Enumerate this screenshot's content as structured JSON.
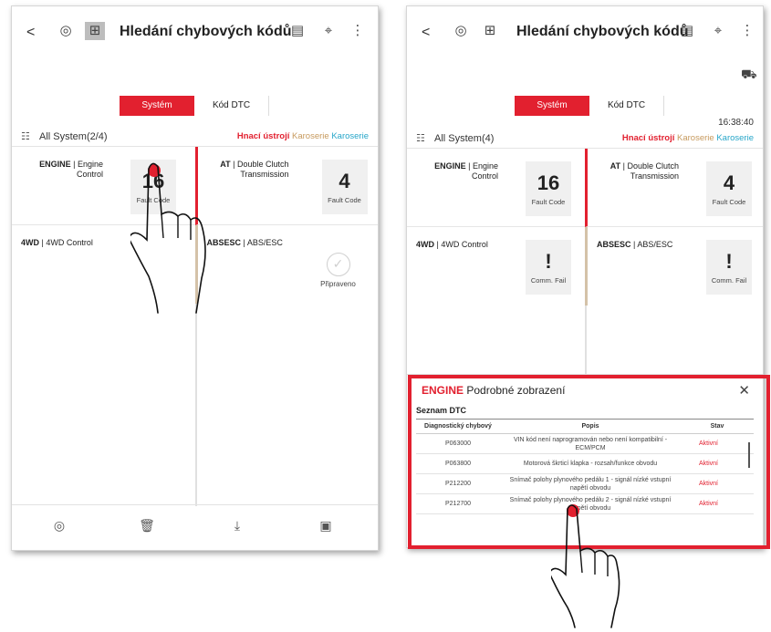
{
  "common": {
    "back": "<",
    "title": "Hledání chybových kódů",
    "tabs": [
      "Systém",
      "Kód DTC"
    ],
    "filter_drive": "Hnací ústrojí",
    "filter_body1": "Karoserie",
    "filter_body2": "Karoserie",
    "fault_caption": "Fault Code",
    "comm_caption": "Comm. Fail",
    "ready_caption": "Připraveno",
    "colors": {
      "accent": "#e2202f",
      "body_filter": "#c79a5e",
      "body_filter2": "#27a6c9"
    }
  },
  "left": {
    "system_label": "All System(2/4)",
    "cells": [
      {
        "name_bold": "ENGINE",
        "name_rest": " | Engine Control",
        "count": "16",
        "caption": "Fault Code"
      },
      {
        "name_bold": "AT",
        "name_rest": " | Double Clutch Transmission",
        "count": "4",
        "caption": "Fault Code"
      },
      {
        "name_bold": "4WD",
        "name_rest": " | 4WD Control"
      },
      {
        "name_bold": "ABSESC",
        "name_rest": " | ABS/ESC",
        "caption": "Připraveno"
      }
    ],
    "bottom_icons": [
      "circle-icon",
      "trash-icon",
      "download-icon",
      "report-icon"
    ]
  },
  "right": {
    "system_label": "All System(4)",
    "time": "16:38:40",
    "cells": [
      {
        "name_bold": "ENGINE",
        "name_rest": " | Engine Control",
        "count": "16",
        "caption": "Fault Code"
      },
      {
        "name_bold": "AT",
        "name_rest": " | Double Clutch Transmission",
        "count": "4",
        "caption": "Fault Code"
      },
      {
        "name_bold": "4WD",
        "name_rest": " | 4WD Control",
        "count": "!",
        "caption": "Comm. Fail"
      },
      {
        "name_bold": "ABSESC",
        "name_rest": " | ABS/ESC",
        "count": "!",
        "caption": "Comm. Fail"
      }
    ],
    "panel": {
      "title_red": "ENGINE",
      "title_rest": " Podrobné zobrazení",
      "close": "✕",
      "subtitle": "Seznam DTC",
      "headers": [
        "Diagnostický chybový",
        "Popis",
        "Stav"
      ],
      "rows": [
        [
          "P063000",
          "VIN kód není naprogramován nebo není kompatibilní - ECM/PCM",
          "Aktivní"
        ],
        [
          "P063800",
          "Motorová škrticí klapka - rozsah/funkce obvodu",
          "Aktivní"
        ],
        [
          "P212200",
          "Snímač polohy plynového pedálu 1 - signál nízké vstupní napětí obvodu",
          "Aktivní"
        ],
        [
          "P212700",
          "Snímač polohy plynového pedálu 2 - signál nízké vstupní napětí obvodu",
          "Aktivní"
        ]
      ]
    }
  }
}
